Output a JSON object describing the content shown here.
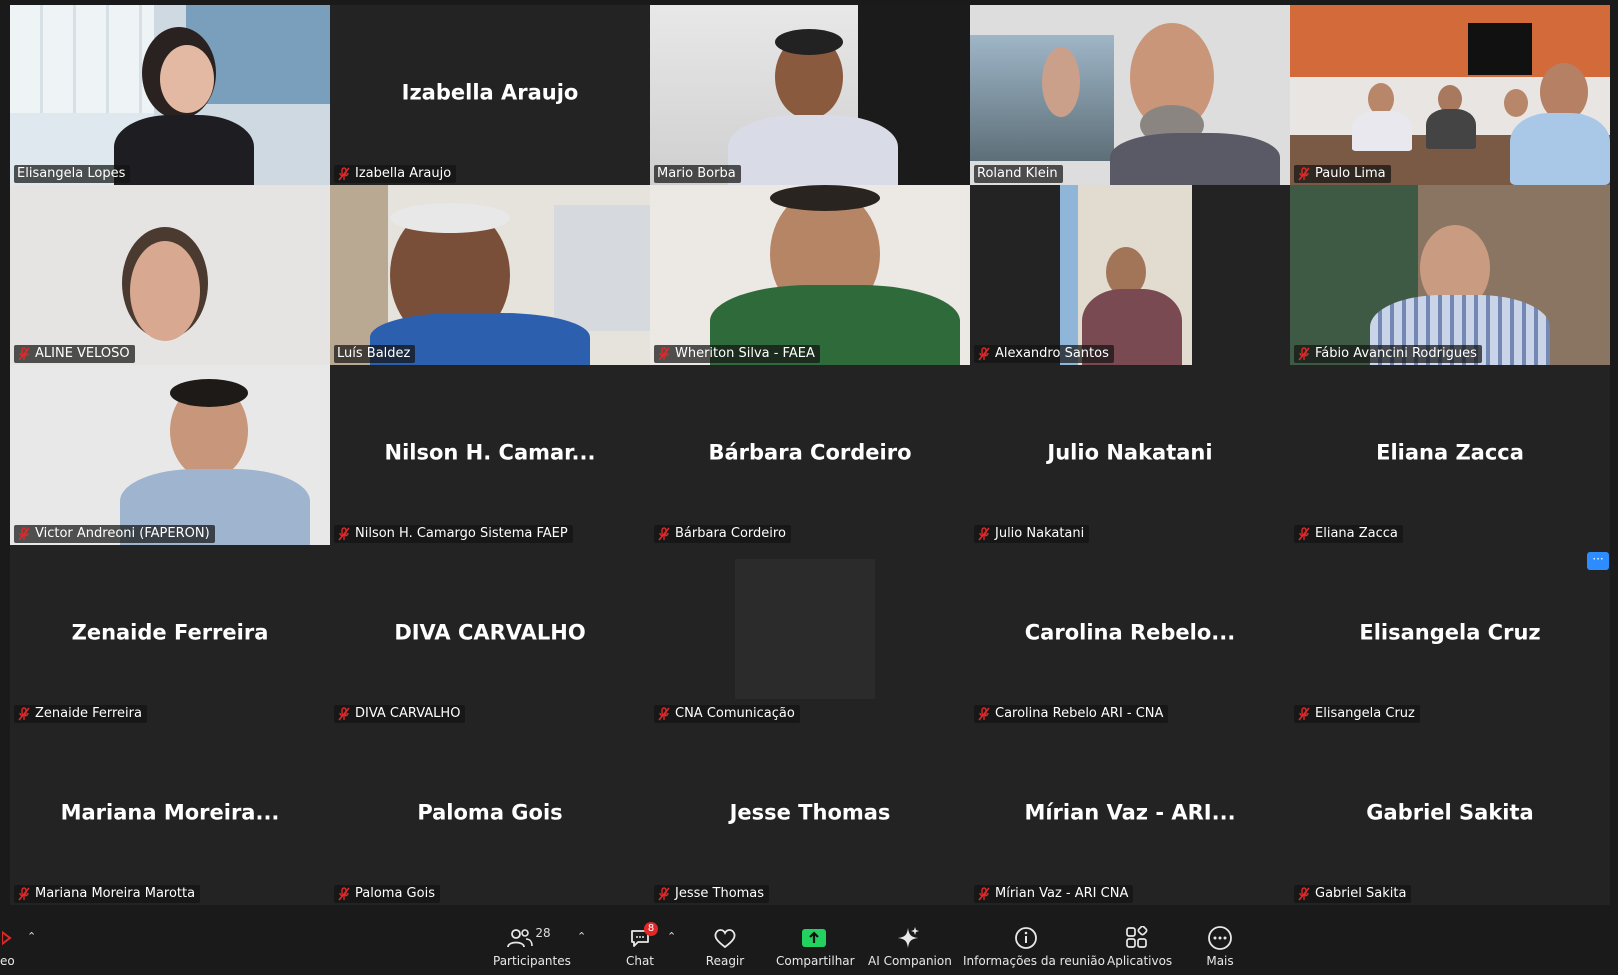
{
  "tiles": [
    {
      "name": "Elisangela Lopes",
      "display": "",
      "mic": false,
      "video": "woman-headset",
      "active": true
    },
    {
      "name": "Izabella Araujo",
      "display": "Izabella Araujo",
      "mic": true,
      "video": ""
    },
    {
      "name": "Mario Borba",
      "display": "",
      "mic": false,
      "video": "man-office"
    },
    {
      "name": "Roland Klein",
      "display": "",
      "mic": false,
      "video": "man-glasses"
    },
    {
      "name": "Paulo Lima",
      "display": "",
      "mic": true,
      "video": "meeting-room"
    },
    {
      "name": "ALINE VELOSO",
      "display": "",
      "mic": true,
      "video": "woman"
    },
    {
      "name": "Luís Baldez",
      "display": "",
      "mic": false,
      "video": "man-headset"
    },
    {
      "name": "Wheriton Silva - FAEA",
      "display": "",
      "mic": true,
      "video": "man-green"
    },
    {
      "name": "Alexandro Santos",
      "display": "",
      "mic": true,
      "video": "man-narrow"
    },
    {
      "name": "Fábio Avancini Rodrigues",
      "display": "",
      "mic": true,
      "video": "man-plaid"
    },
    {
      "name": "Victor Andreoni (FAPERON)",
      "display": "",
      "mic": true,
      "video": "man-young"
    },
    {
      "name": "Nilson H. Camargo Sistema FAEP",
      "display": "Nilson  H.  Camar...",
      "mic": true,
      "video": ""
    },
    {
      "name": "Bárbara Cordeiro",
      "display": "Bárbara Cordeiro",
      "mic": true,
      "video": ""
    },
    {
      "name": "Julio Nakatani",
      "display": "Julio Nakatani",
      "mic": true,
      "video": ""
    },
    {
      "name": "Eliana Zacca",
      "display": "Eliana Zacca",
      "mic": true,
      "video": ""
    },
    {
      "name": "Zenaide Ferreira",
      "display": "Zenaide Ferreira",
      "mic": true,
      "video": ""
    },
    {
      "name": "DIVA CARVALHO",
      "display": "DIVA CARVALHO",
      "mic": true,
      "video": ""
    },
    {
      "name": "CNA Comunicação",
      "display": "",
      "mic": true,
      "video": "dark-thumb"
    },
    {
      "name": "Carolina Rebelo ARI - CNA",
      "display": "Carolina  Rebelo...",
      "mic": true,
      "video": ""
    },
    {
      "name": "Elisangela Cruz",
      "display": "Elisangela Cruz",
      "mic": true,
      "video": ""
    },
    {
      "name": "Mariana Moreira Marotta",
      "display": "Mariana  Moreira...",
      "mic": true,
      "video": ""
    },
    {
      "name": "Paloma Gois",
      "display": "Paloma Gois",
      "mic": true,
      "video": ""
    },
    {
      "name": "Jesse Thomas",
      "display": "Jesse Thomas",
      "mic": true,
      "video": ""
    },
    {
      "name": "Mírian Vaz - ARI CNA",
      "display": "Mírian Vaz  - ARI...",
      "mic": true,
      "video": ""
    },
    {
      "name": "Gabriel Sakita",
      "display": "Gabriel Sakita",
      "mic": true,
      "video": ""
    }
  ],
  "more_label": "···",
  "toolbar": {
    "left_label": "eo",
    "participants_label": "Participantes",
    "participants_count": "28",
    "chat_label": "Chat",
    "chat_badge": "8",
    "react_label": "Reagir",
    "share_label": "Compartilhar",
    "ai_label": "AI Companion",
    "info_label": "Informações da reunião",
    "apps_label": "Aplicativos",
    "more_label": "Mais"
  },
  "colors": {
    "active_border": "#23d160",
    "muted_mic": "#e02828",
    "share_green": "#23d160",
    "accent_blue": "#2d8cff"
  }
}
